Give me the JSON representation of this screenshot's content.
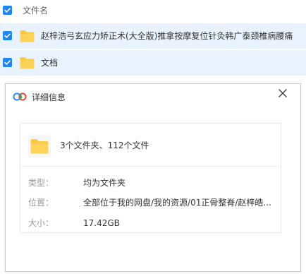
{
  "list": {
    "header_label": "文件名",
    "rows": [
      {
        "name": "赵梓浩弓玄应力矫正术(大全版)推拿按摩复位针灸韩广泰颈椎病腰痛",
        "checked": true
      },
      {
        "name": "文档",
        "checked": true
      }
    ]
  },
  "dialog": {
    "title": "详细信息",
    "summary": "3个文件夹、112个文件",
    "type_label": "类型：",
    "type_value": "均为文件夹",
    "location_label": "位置：",
    "location_value": "全部位于我的网盘/我的资源/01正骨整脊/赵梓皓...",
    "size_label": "大小：",
    "size_value": "17.42GB"
  },
  "colors": {
    "accent": "#1e86f0",
    "row_selected_bg": "#e8f3ff",
    "folder_yellow": "#ffc83d"
  }
}
